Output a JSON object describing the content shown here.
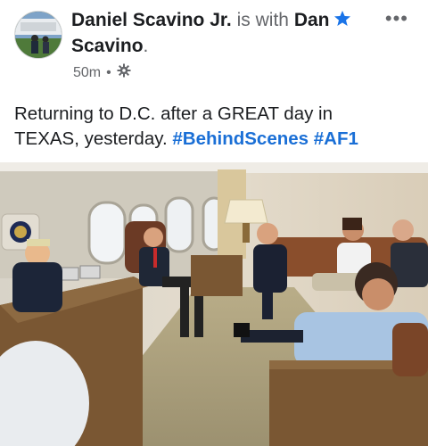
{
  "post": {
    "author": "Daniel Scavino Jr.",
    "with_word": "is with",
    "with_name_first": "Dan",
    "with_name_last": "Scavino",
    "with_period": ".",
    "timestamp": "50m",
    "separator": "•",
    "audience_icon": "gear-icon",
    "verified_icon": "star-badge-icon",
    "more_icon": "•••",
    "text_line1": "Returning to D.C. after a GREAT day in",
    "text_line2_plain": "TEXAS, yesterday.",
    "hashtags": [
      "#BehindScenes",
      "#AF1"
    ],
    "photo_subject": "Air Force One conference room"
  },
  "colors": {
    "hashtag": "#1a6fd6",
    "verified": "#1a74e8",
    "secondary_text": "#65676b"
  }
}
